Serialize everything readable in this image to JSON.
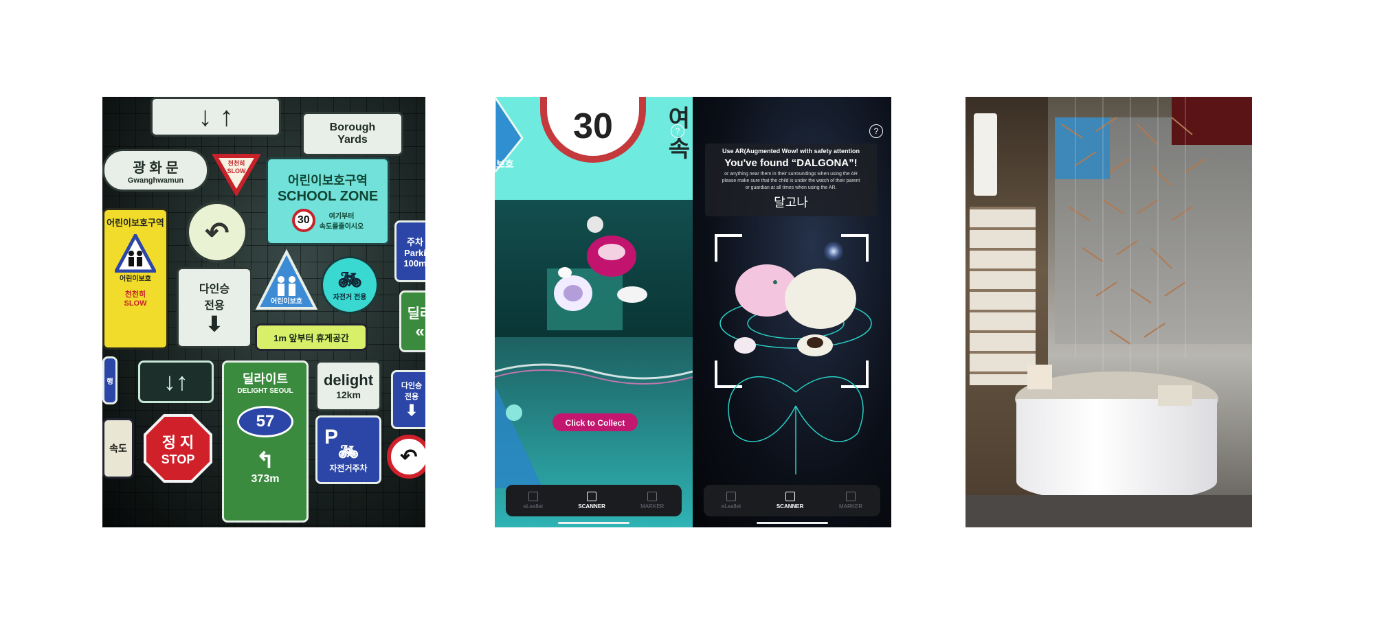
{
  "panel_signs": {
    "road": "Borough\nYards",
    "place": "광 화 문",
    "place_en": "Gwanghwamun",
    "slow": "천천히\nSLOW",
    "school_kr": "어린이보호구역",
    "school_en": "SCHOOL ZONE",
    "speed_30": "30",
    "slow_down_kr": "여기부터\n속도를줄이시오",
    "yellow_zone": "어린이보호구역",
    "yellow_children": "어린이보호",
    "yellow_slow": "천천히\nSLOW",
    "carpool": "다인승\n전용",
    "children_protect": "어린이보호",
    "bike_only": "자전거 전용",
    "rest_area": "1m 앞부터 휴게공간",
    "parking": "주차\nParki\n100m",
    "delight_kr": "딜라이트",
    "delight_en": "DELIGHT SEOUL",
    "route_57": "57",
    "distance_373": "373m",
    "delight_brand": "delight",
    "distance_12": "12km",
    "bike_parking_p": "P",
    "bike_parking": "자전거주차",
    "stop_kr": "정 지",
    "stop_en": "STOP",
    "carpool_2": "다인승\n전용",
    "speed_kr": "속도",
    "delight_side": "딜라",
    "lane_kr": "행"
  },
  "phone_left": {
    "speed_30": "30",
    "kr_partial": "여\n속",
    "kr_side": "보호",
    "help": "?",
    "collect_button": "Click to Collect",
    "nav": [
      {
        "label": "eLeaflet",
        "icon": "leaflet-icon"
      },
      {
        "label": "SCANNER",
        "icon": "scanner-icon"
      },
      {
        "label": "MARKER",
        "icon": "marker-icon"
      }
    ]
  },
  "phone_right": {
    "help": "?",
    "notice_line": "Use AR(Augmented Wow! with safety attention",
    "found": "You've found “DALGONA”!",
    "small": "or anything near them in their surroundings when using the AR\nplease make sure that the child is under the watch of their parent\nor guardian at all times when using the AR.",
    "kr": "달고나",
    "nav": [
      {
        "label": "eLeaflet",
        "icon": "leaflet-icon"
      },
      {
        "label": "SCANNER",
        "icon": "scanner-icon"
      },
      {
        "label": "MARKER",
        "icon": "marker-icon"
      }
    ]
  }
}
